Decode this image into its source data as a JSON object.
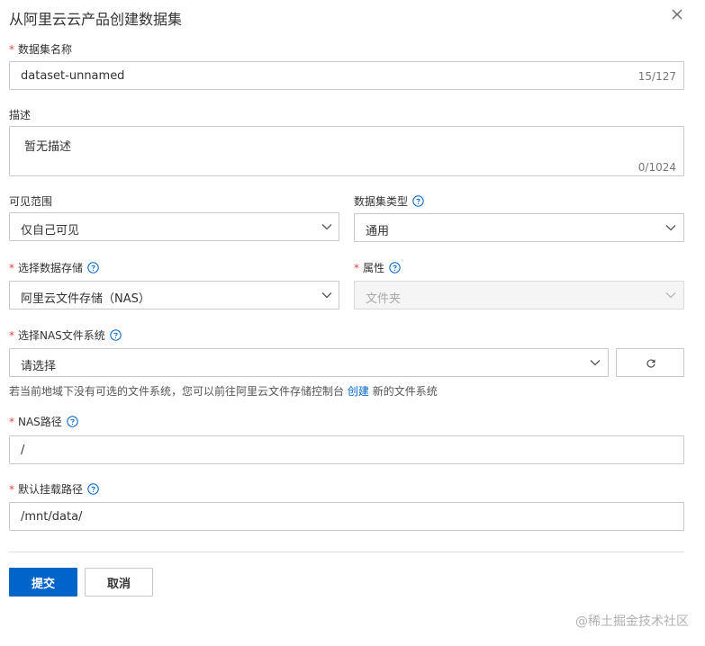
{
  "dialog": {
    "title": "从阿里云云产品创建数据集"
  },
  "fields": {
    "name": {
      "label": "数据集名称",
      "required_mark": "*",
      "value": "dataset-unnamed",
      "counter": "15/127"
    },
    "description": {
      "label": "描述",
      "placeholder": "暂无描述",
      "counter": "0/1024"
    },
    "visibility": {
      "label": "可见范围",
      "value": "仅自己可见"
    },
    "type": {
      "label": "数据集类型",
      "value": "通用"
    },
    "storage": {
      "label": "选择数据存储",
      "required_mark": "*",
      "value": "阿里云文件存储（NAS）"
    },
    "attribute": {
      "label": "属性",
      "required_mark": "*",
      "value": "文件夹"
    },
    "nas_fs": {
      "label": "选择NAS文件系统",
      "required_mark": "*",
      "placeholder": "请选择"
    },
    "nas_path": {
      "label": "NAS路径",
      "required_mark": "*",
      "value": "/"
    },
    "mount_path": {
      "label": "默认挂载路径",
      "required_mark": "*",
      "value": "/mnt/data/"
    }
  },
  "hint": {
    "before": "若当前地域下没有可选的文件系统，您可以前往阿里云文件存储控制台",
    "link": "创建",
    "after": "新的文件系统"
  },
  "buttons": {
    "submit": "提交",
    "cancel": "取消"
  },
  "watermark": "@稀土掘金技术社区",
  "icons": {
    "close": "close-icon",
    "help": "question-circle-icon",
    "dropdown": "chevron-down-icon",
    "refresh": "refresh-icon"
  },
  "colors": {
    "primary": "#0064c8",
    "required": "#e64545",
    "help_icon": "#0064c8"
  }
}
